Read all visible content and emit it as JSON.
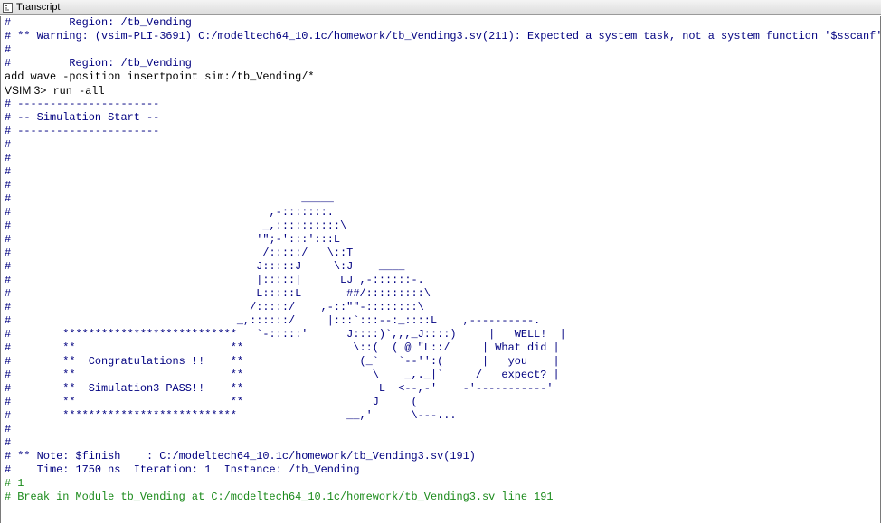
{
  "window": {
    "title": "Transcript"
  },
  "transcript": {
    "lines": [
      {
        "type": "output",
        "text": "#         Region: /tb_Vending"
      },
      {
        "type": "output",
        "text": "# ** Warning: (vsim-PLI-3691) C:/modeltech64_10.1c/homework/tb_Vending3.sv(211): Expected a system task, not a system function '$sscanf'."
      },
      {
        "type": "output",
        "text": "#"
      },
      {
        "type": "output",
        "text": "#         Region: /tb_Vending"
      },
      {
        "type": "command",
        "text": "add wave -position insertpoint sim:/tb_Vending/*"
      },
      {
        "type": "prompt",
        "prompt": "VSIM 3>",
        "text": " run -all"
      },
      {
        "type": "output",
        "text": "# ----------------------"
      },
      {
        "type": "output",
        "text": "# -- Simulation Start --"
      },
      {
        "type": "output",
        "text": "# ----------------------"
      },
      {
        "type": "output",
        "text": "#"
      },
      {
        "type": "output",
        "text": "#"
      },
      {
        "type": "output",
        "text": "#"
      },
      {
        "type": "output",
        "text": "#"
      },
      {
        "type": "output",
        "text": "#                                             _____"
      },
      {
        "type": "output",
        "text": "#                                        ,-:::::::."
      },
      {
        "type": "output",
        "text": "#                                       _,::::::::::\\"
      },
      {
        "type": "output",
        "text": "#                                      '\";-':::':::L"
      },
      {
        "type": "output",
        "text": "#                                       /:::::/   \\::T"
      },
      {
        "type": "output",
        "text": "#                                      J:::::J     \\:J    ____"
      },
      {
        "type": "output",
        "text": "#                                      |:::::|      LJ ,-::::::-."
      },
      {
        "type": "output",
        "text": "#                                      L:::::L       ##/:::::::::\\"
      },
      {
        "type": "output",
        "text": "#                                     /:::::/    ,-::\"\"-::::::::\\"
      },
      {
        "type": "output",
        "text": "#                                   _,::::::/     |:::`:::--:_::::L    ,----------."
      },
      {
        "type": "output",
        "text": "#        ***************************   `-:::::'      J::::)`,,,_J::::)     |   WELL!  |"
      },
      {
        "type": "output",
        "text": "#        **                        **                 \\::(  ( @ \"L::/     | What did |"
      },
      {
        "type": "output",
        "text": "#        **  Congratulations !!    **                  (_`   `--'':(      |   you    |"
      },
      {
        "type": "output",
        "text": "#        **                        **                    \\    _,._|`     /   expect? |"
      },
      {
        "type": "output",
        "text": "#        **  Simulation3 PASS!!    **                     L  <--,-'    -'-----------'"
      },
      {
        "type": "output",
        "text": "#        **                        **                    J     ("
      },
      {
        "type": "output",
        "text": "#        ***************************                 __,'      \\---..."
      },
      {
        "type": "output",
        "text": "#"
      },
      {
        "type": "output",
        "text": "#"
      },
      {
        "type": "output",
        "text": "# ** Note: $finish    : C:/modeltech64_10.1c/homework/tb_Vending3.sv(191)"
      },
      {
        "type": "output",
        "text": "#    Time: 1750 ns  Iteration: 1  Instance: /tb_Vending"
      },
      {
        "type": "result",
        "text": "# 1"
      },
      {
        "type": "result",
        "text": "# Break in Module tb_Vending at C:/modeltech64_10.1c/homework/tb_Vending3.sv line 191"
      }
    ]
  },
  "colors": {
    "output": "#000080",
    "command": "#000000",
    "result": "#1a8a1a"
  },
  "icons": {
    "window_icon": "transcript-icon"
  }
}
